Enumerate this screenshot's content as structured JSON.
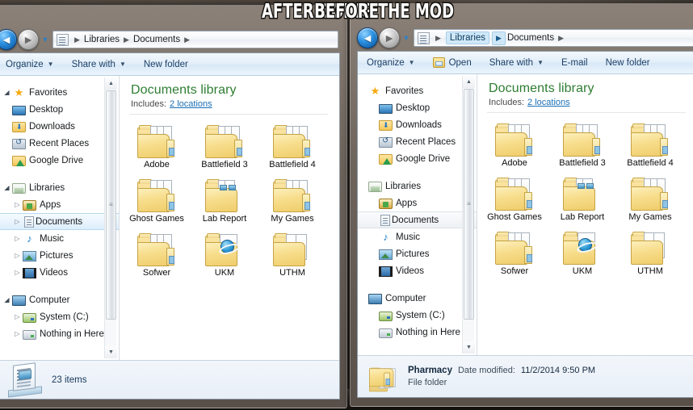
{
  "captions": {
    "left": "AFTER DOING THE MOD",
    "right": "BEFORE"
  },
  "panels": {
    "after": {
      "nav": {
        "back_icon": "back-arrow-icon",
        "forward_icon": "forward-arrow-icon",
        "recent_pages_icon": "chevron-down-icon",
        "address_icon": "library-document-icon",
        "breadcrumbs": [
          "Libraries",
          "Documents"
        ],
        "highlighted_crumb": null
      },
      "toolbar": [
        {
          "label": "Organize",
          "has_caret": true,
          "icon": null
        },
        {
          "label": "Share with",
          "has_caret": true,
          "icon": null
        },
        {
          "label": "New folder",
          "has_caret": false,
          "icon": null
        }
      ],
      "navpane": {
        "has_expanders": true,
        "groups": [
          {
            "header": {
              "label": "Favorites",
              "icon": "star-icon",
              "expander": "expanded"
            },
            "items": [
              {
                "label": "Desktop",
                "icon": "desktop-icon",
                "expander": "none"
              },
              {
                "label": "Downloads",
                "icon": "downloads-folder-icon",
                "expander": "none"
              },
              {
                "label": "Recent Places",
                "icon": "recent-places-icon",
                "expander": "none"
              },
              {
                "label": "Google Drive",
                "icon": "google-drive-icon",
                "expander": "none"
              }
            ]
          },
          {
            "header": {
              "label": "Libraries",
              "icon": "libraries-icon",
              "expander": "expanded"
            },
            "items": [
              {
                "label": "Apps",
                "icon": "apps-library-icon",
                "expander": "collapsed"
              },
              {
                "label": "Documents",
                "icon": "documents-library-icon",
                "expander": "collapsed",
                "selected": true
              },
              {
                "label": "Music",
                "icon": "music-library-icon",
                "expander": "collapsed"
              },
              {
                "label": "Pictures",
                "icon": "pictures-library-icon",
                "expander": "collapsed"
              },
              {
                "label": "Videos",
                "icon": "videos-library-icon",
                "expander": "collapsed"
              }
            ]
          },
          {
            "header": {
              "label": "Computer",
              "icon": "computer-icon",
              "expander": "expanded"
            },
            "items": [
              {
                "label": "System (C:)",
                "icon": "system-drive-icon",
                "expander": "collapsed"
              },
              {
                "label": "Nothing in Here",
                "icon": "drive-icon",
                "expander": "collapsed"
              }
            ]
          }
        ]
      },
      "content": {
        "library_title": "Documents library",
        "includes_label": "Includes:",
        "includes_link": "2 locations",
        "folders": [
          {
            "name": "Adobe",
            "style": "plain"
          },
          {
            "name": "Battlefield 3",
            "style": "plain"
          },
          {
            "name": "Battlefield 4",
            "style": "plain"
          },
          {
            "name": "Ghost Games",
            "style": "plain"
          },
          {
            "name": "Lab Report",
            "style": "lab"
          },
          {
            "name": "My Games",
            "style": "plain"
          },
          {
            "name": "Sofwer",
            "style": "plain"
          },
          {
            "name": "UKM",
            "style": "ie"
          },
          {
            "name": "UTHM",
            "style": "ie2"
          }
        ]
      },
      "status": {
        "type": "count",
        "icon": "documents-library-icon",
        "text": "23 items"
      }
    },
    "before": {
      "nav": {
        "back_icon": "back-arrow-icon",
        "forward_icon": "forward-arrow-icon",
        "recent_pages_icon": "chevron-down-icon",
        "address_icon": "library-document-icon",
        "breadcrumbs": [
          "Libraries",
          "Documents"
        ],
        "highlighted_crumb": "Libraries"
      },
      "toolbar": [
        {
          "label": "Organize",
          "has_caret": true,
          "icon": null
        },
        {
          "label": "Open",
          "has_caret": false,
          "icon": "open-folder-icon"
        },
        {
          "label": "Share with",
          "has_caret": true,
          "icon": null
        },
        {
          "label": "E-mail",
          "has_caret": false,
          "icon": null
        },
        {
          "label": "New folder",
          "has_caret": false,
          "icon": null
        }
      ],
      "navpane": {
        "has_expanders": false,
        "groups": [
          {
            "header": {
              "label": "Favorites",
              "icon": "star-icon",
              "expander": "none"
            },
            "items": [
              {
                "label": "Desktop",
                "icon": "desktop-icon",
                "expander": "none"
              },
              {
                "label": "Downloads",
                "icon": "downloads-folder-icon",
                "expander": "none"
              },
              {
                "label": "Recent Places",
                "icon": "recent-places-icon",
                "expander": "none"
              },
              {
                "label": "Google Drive",
                "icon": "google-drive-icon",
                "expander": "none"
              }
            ]
          },
          {
            "header": {
              "label": "Libraries",
              "icon": "libraries-icon",
              "expander": "none"
            },
            "items": [
              {
                "label": "Apps",
                "icon": "apps-library-icon",
                "expander": "none"
              },
              {
                "label": "Documents",
                "icon": "documents-library-icon",
                "expander": "none",
                "selected": true
              },
              {
                "label": "Music",
                "icon": "music-library-icon",
                "expander": "none"
              },
              {
                "label": "Pictures",
                "icon": "pictures-library-icon",
                "expander": "none"
              },
              {
                "label": "Videos",
                "icon": "videos-library-icon",
                "expander": "none"
              }
            ]
          },
          {
            "header": {
              "label": "Computer",
              "icon": "computer-icon",
              "expander": "none"
            },
            "items": [
              {
                "label": "System (C:)",
                "icon": "system-drive-icon",
                "expander": "none"
              },
              {
                "label": "Nothing in Here",
                "icon": "drive-icon",
                "expander": "none"
              }
            ]
          }
        ]
      },
      "content": {
        "library_title": "Documents library",
        "includes_label": "Includes:",
        "includes_link": "2 locations",
        "folders": [
          {
            "name": "Adobe",
            "style": "plain"
          },
          {
            "name": "Battlefield 3",
            "style": "plain"
          },
          {
            "name": "Battlefield 4",
            "style": "plain"
          },
          {
            "name": "Ghost Games",
            "style": "plain"
          },
          {
            "name": "Lab Report",
            "style": "lab"
          },
          {
            "name": "My Games",
            "style": "plain"
          },
          {
            "name": "Sofwer",
            "style": "plain"
          },
          {
            "name": "UKM",
            "style": "ie"
          },
          {
            "name": "UTHM",
            "style": "ie2"
          }
        ]
      },
      "status": {
        "type": "details",
        "icon": "folder-icon",
        "name": "Pharmacy",
        "date_label": "Date modified:",
        "date_value": "11/2/2014 9:50 PM",
        "file_type": "File folder"
      }
    }
  },
  "colors": {
    "library_title": "#2e7d32",
    "link": "#1a6fb5",
    "selection": "#dcedfb",
    "folder_yellow": "#f7dd8c"
  },
  "glyphs": {
    "back": "◄",
    "forward": "►",
    "caret_down": "▼",
    "sep": "▶",
    "expander_open": "◢",
    "expander_closed": "▷",
    "scroll_up": "▲",
    "scroll_down": "▼",
    "grip": "≡",
    "star": "★",
    "music": "♪"
  }
}
